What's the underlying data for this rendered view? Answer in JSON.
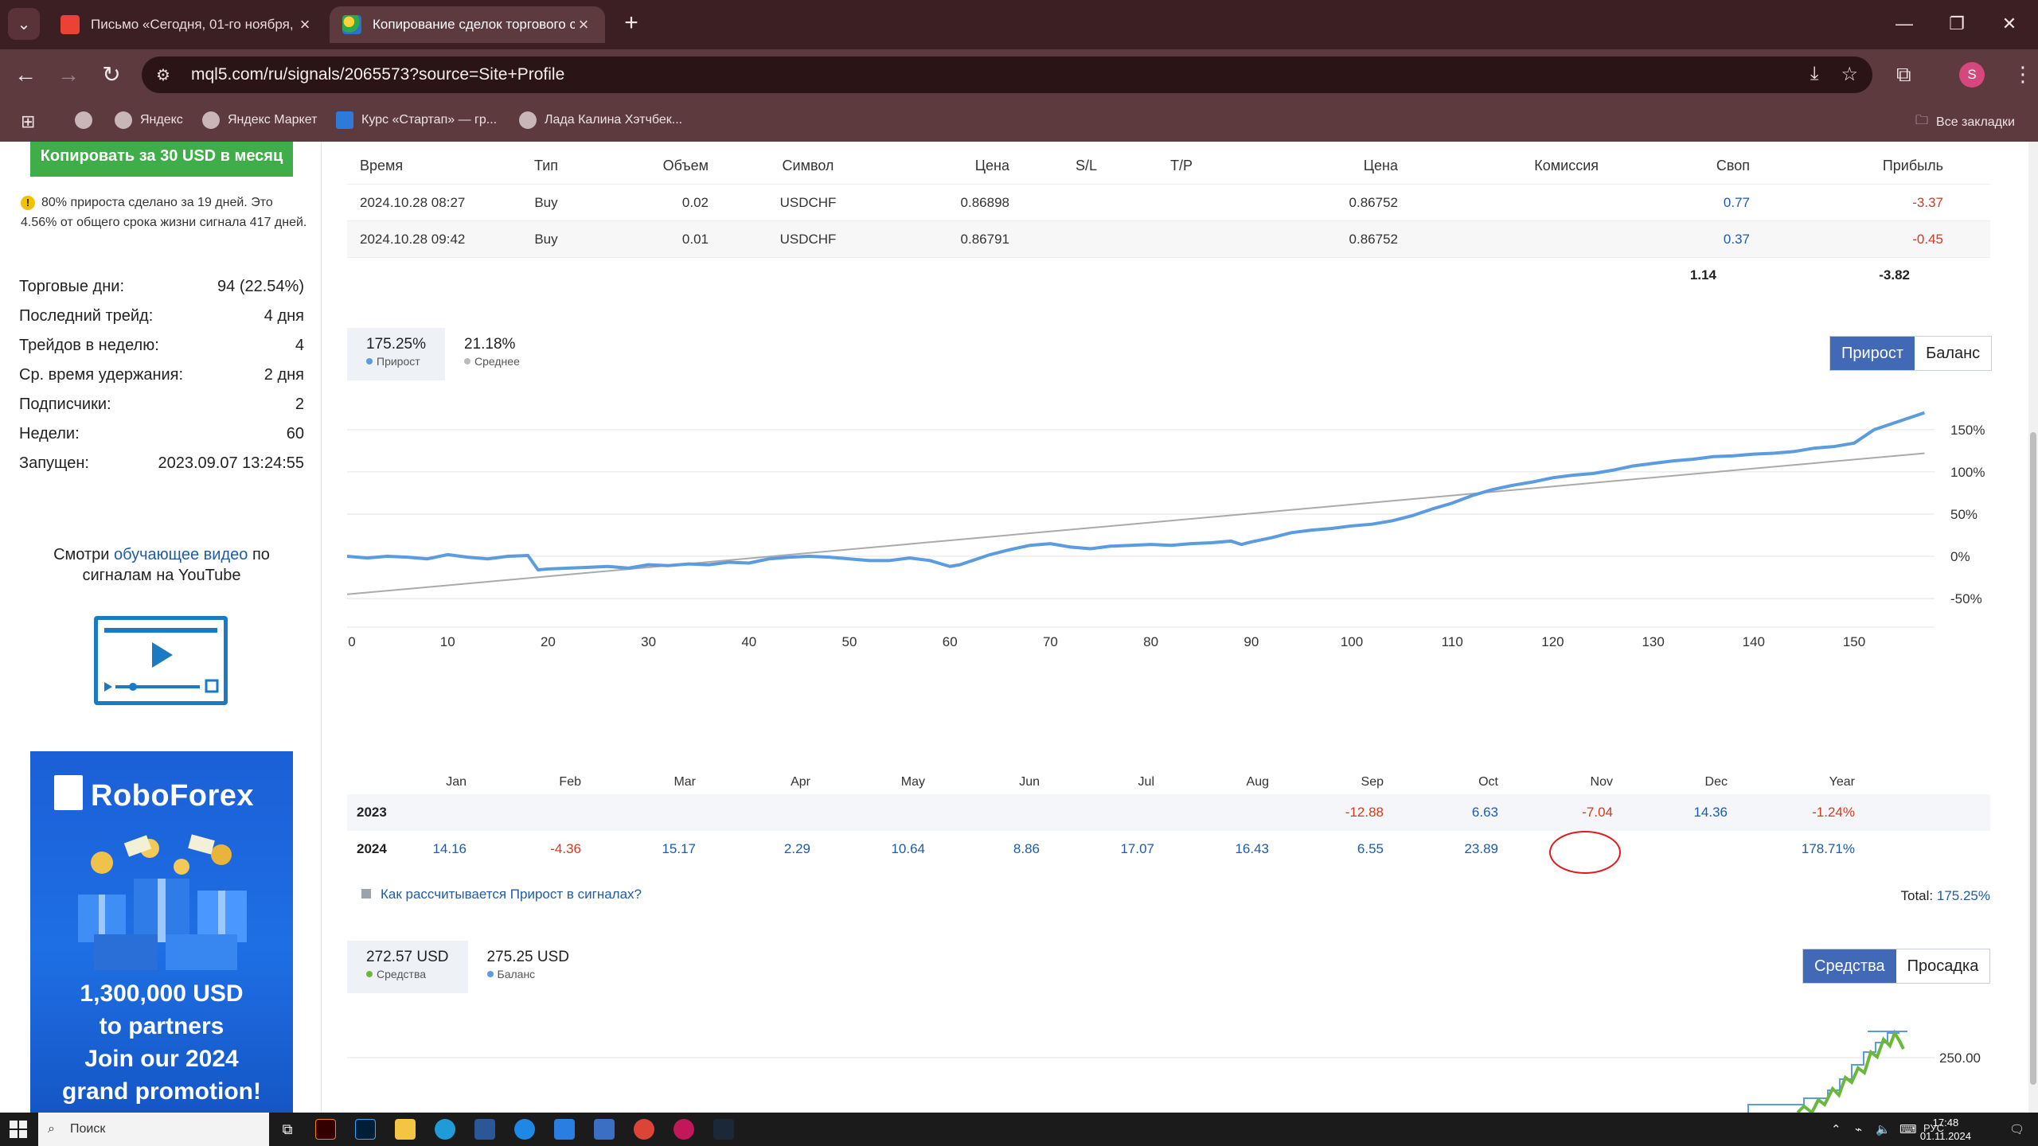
{
  "browser": {
    "tabs": [
      {
        "title": "Письмо «Сегодня, 01-го ноября,",
        "active": false
      },
      {
        "title": "Копирование сделок торгового с",
        "active": true
      }
    ],
    "url": "mql5.com/ru/signals/2065573?source=Site+Profile",
    "profile_initial": "S",
    "bookmarks": [
      "Яндекс",
      "Яндекс Маркет",
      "Курс «Стартап» — гр...",
      "Лада Калина Хэтчбек..."
    ],
    "all_bookmarks": "Все закладки"
  },
  "sidebar": {
    "copy_button": "Копировать за 30 USD в месяц",
    "note": "80% прироста сделано за 19 дней. Это 4.56% от общего срока жизни сигнала 417 дней.",
    "stats": [
      {
        "label": "Торговые дни:",
        "value": "94 (22.54%)"
      },
      {
        "label": "Последний трейд:",
        "value": "4 дня"
      },
      {
        "label": "Трейдов в неделю:",
        "value": "4"
      },
      {
        "label": "Ср. время удержания:",
        "value": "2 дня"
      },
      {
        "label": "Подписчики:",
        "value": "2"
      },
      {
        "label": "Недели:",
        "value": "60"
      },
      {
        "label": "Запущен:",
        "value": "2023.09.07 13:24:55"
      }
    ],
    "video_pre": "Смотри ",
    "video_link": "обучающее видео",
    "video_post": " по сигналам на YouTube",
    "ad": {
      "brand": "RoboForex",
      "line1": "1,300,000 USD",
      "line2": "to partners",
      "line3": "Join our 2024",
      "line4": "grand promotion!"
    }
  },
  "deals": {
    "headers": [
      "Время",
      "Тип",
      "Объем",
      "Символ",
      "Цена",
      "S/L",
      "T/P",
      "Цена",
      "Комиссия",
      "Своп",
      "Прибыль"
    ],
    "rows": [
      [
        "2024.10.28 08:27",
        "Buy",
        "0.02",
        "USDCHF",
        "0.86898",
        "",
        "",
        "0.86752",
        "",
        "0.77",
        "-3.37"
      ],
      [
        "2024.10.28 09:42",
        "Buy",
        "0.01",
        "USDCHF",
        "0.86791",
        "",
        "",
        "0.86752",
        "",
        "0.37",
        "-0.45"
      ]
    ],
    "total_swap": "1.14",
    "total_profit": "-3.82"
  },
  "growth": {
    "tab_growth_value": "175.25%",
    "tab_growth_label": "Прирост",
    "tab_avg_value": "21.18%",
    "tab_avg_label": "Среднее",
    "toggle_on": "Прирост",
    "toggle_off": "Баланс",
    "how_link": "Как рассчитывается Прирост в сигналах?",
    "total_label": "Total:",
    "total_value": "175.25%"
  },
  "chart_data": {
    "type": "line",
    "x_ticks": [
      "0",
      "10",
      "20",
      "30",
      "40",
      "50",
      "60",
      "70",
      "80",
      "90",
      "100",
      "110",
      "120",
      "130",
      "140",
      "150"
    ],
    "y_ticks": [
      "150%",
      "100%",
      "50%",
      "0%",
      "-50%"
    ],
    "xlim": [
      0,
      158
    ],
    "ylim": [
      -65,
      180
    ],
    "series": [
      {
        "name": "Прирост",
        "color": "#5b9be0",
        "x": [
          0,
          2,
          4,
          6,
          8,
          10,
          12,
          14,
          16,
          18,
          19,
          20,
          22,
          24,
          26,
          28,
          30,
          32,
          34,
          36,
          38,
          40,
          42,
          44,
          46,
          48,
          50,
          52,
          54,
          56,
          58,
          60,
          61,
          62,
          64,
          66,
          68,
          70,
          72,
          74,
          76,
          78,
          80,
          82,
          84,
          86,
          88,
          89,
          90,
          92,
          94,
          96,
          98,
          100,
          102,
          104,
          106,
          108,
          110,
          112,
          114,
          116,
          118,
          120,
          122,
          124,
          126,
          128,
          130,
          132,
          134,
          136,
          138,
          140,
          142,
          144,
          146,
          148,
          150,
          152,
          154,
          156,
          157
        ],
        "y": [
          0,
          -2,
          0,
          -1,
          -3,
          2,
          -1,
          -3,
          0,
          1,
          -16,
          -15,
          -14,
          -13,
          -12,
          -14,
          -10,
          -11,
          -9,
          -10,
          -7,
          -8,
          -3,
          -1,
          0,
          -1,
          -3,
          -5,
          -5,
          -2,
          -5,
          -12,
          -10,
          -6,
          2,
          8,
          13,
          15,
          11,
          9,
          12,
          13,
          14,
          13,
          15,
          16,
          18,
          14,
          17,
          22,
          28,
          31,
          33,
          36,
          38,
          42,
          48,
          56,
          63,
          72,
          79,
          84,
          88,
          93,
          96,
          98,
          102,
          107,
          110,
          113,
          115,
          118,
          119,
          121,
          122,
          124,
          128,
          130,
          134,
          150,
          158,
          166,
          170
        ]
      },
      {
        "name": "Среднее",
        "color": "#aaaaaa",
        "x": [
          0,
          157
        ],
        "y": [
          -45,
          122
        ]
      }
    ]
  },
  "monthly": {
    "headers": [
      "Jan",
      "Feb",
      "Mar",
      "Apr",
      "May",
      "Jun",
      "Jul",
      "Aug",
      "Sep",
      "Oct",
      "Nov",
      "Dec",
      "Year"
    ],
    "rows": [
      {
        "year": "2023",
        "values": [
          "",
          "",
          "",
          "",
          "",
          "",
          "",
          "",
          "-12.88",
          "6.63",
          "-7.04",
          "14.36",
          "-1.24%"
        ]
      },
      {
        "year": "2024",
        "values": [
          "14.16",
          "-4.36",
          "15.17",
          "2.29",
          "10.64",
          "8.86",
          "17.07",
          "16.43",
          "6.55",
          "23.89",
          "",
          "",
          "178.71%"
        ]
      }
    ]
  },
  "equity": {
    "tab_eq_value": "272.57 USD",
    "tab_eq_label": "Средства",
    "tab_bal_value": "275.25 USD",
    "tab_bal_label": "Баланс",
    "toggle_on": "Средства",
    "toggle_off": "Просадка",
    "y_tick": "250.00"
  },
  "colors": {
    "accent": "#4169b6",
    "copy_green": "#3fae49",
    "growth_line": "#5b9be0",
    "equity_line": "#6ab73a",
    "negative": "#d03b20",
    "positive": "#1f5ba8"
  },
  "taskbar": {
    "search_placeholder": "Поиск",
    "lang": "РУС",
    "time": "17:48",
    "date": "01.11.2024"
  }
}
